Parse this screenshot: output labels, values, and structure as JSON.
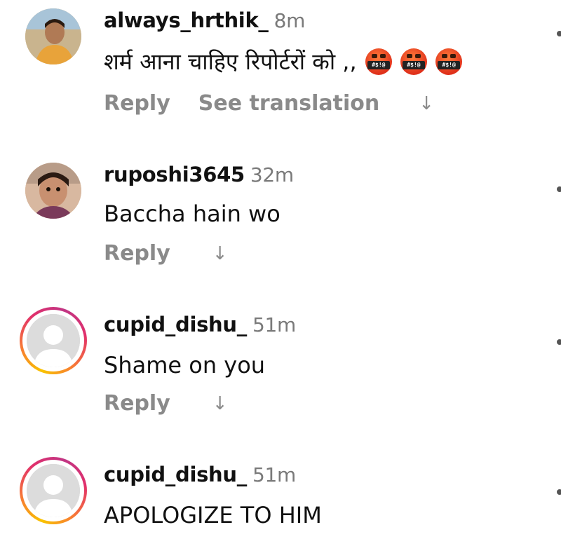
{
  "comments": [
    {
      "username": "always_hrthik_",
      "time": "8m",
      "text": "शर्म आना चाहिए रिपोर्टरों को ,,",
      "emoji_label": "#$!@",
      "emoji_count": 3,
      "reply_label": "Reply",
      "translate_label": "See translation",
      "avatar": "profile-photo"
    },
    {
      "username": "ruposhi3645",
      "time": "32m",
      "text": "Baccha hain wo",
      "reply_label": "Reply",
      "avatar": "profile-photo"
    },
    {
      "username": "cupid_dishu_",
      "time": "51m",
      "text": "Shame on you",
      "reply_label": "Reply",
      "avatar": "default-avatar-story-ring"
    },
    {
      "username": "cupid_dishu_",
      "time": "51m",
      "text": "APOLOGIZE TO HIM",
      "avatar": "default-avatar-story-ring"
    }
  ],
  "icons": {
    "arrow": "↓",
    "arrow_name": "down-arrow-icon"
  }
}
